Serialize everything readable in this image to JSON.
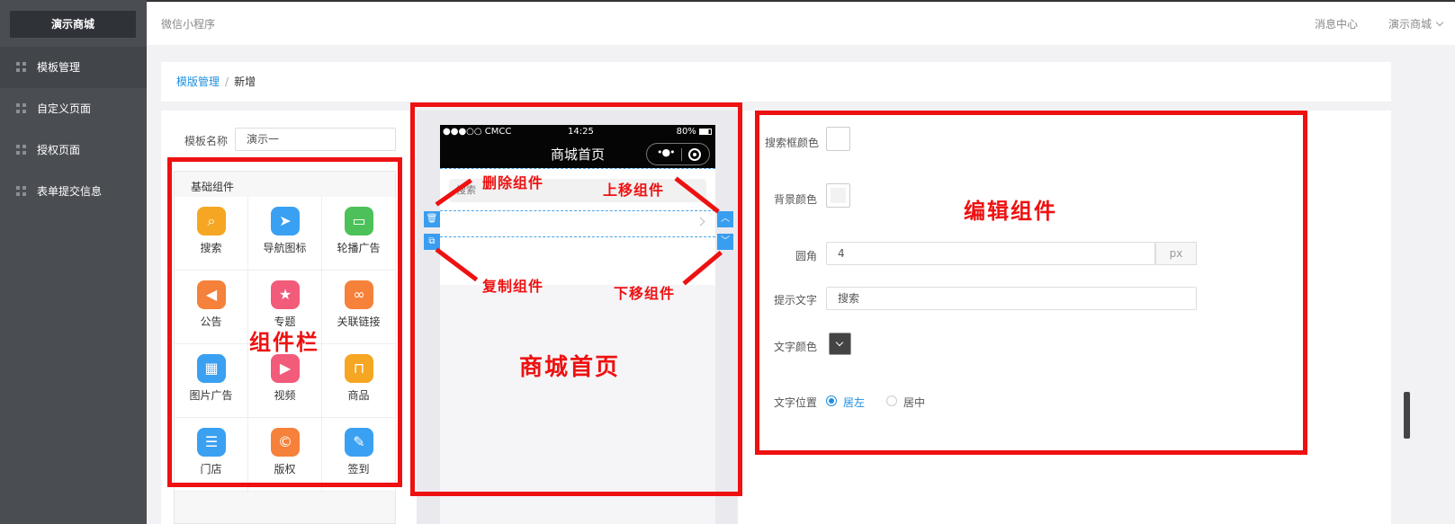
{
  "sidebar": {
    "brand": "演示商城",
    "items": [
      {
        "label": "模板管理"
      },
      {
        "label": "自定义页面"
      },
      {
        "label": "授权页面"
      },
      {
        "label": "表单提交信息"
      }
    ]
  },
  "topbar": {
    "app_title": "微信小程序",
    "messages": "消息中心",
    "user": "演示商城"
  },
  "breadcrumb": {
    "parent": "模版管理",
    "separator": "/",
    "current": "新增"
  },
  "form": {
    "name_label": "模板名称",
    "name_value": "演示一"
  },
  "components": {
    "title": "基础组件",
    "items": [
      {
        "label": "搜索",
        "icon": "search-icon",
        "color": "#f5a623"
      },
      {
        "label": "导航图标",
        "icon": "navigation-icon",
        "color": "#3aa0f2"
      },
      {
        "label": "轮播广告",
        "icon": "carousel-icon",
        "color": "#4cc15a"
      },
      {
        "label": "公告",
        "icon": "megaphone-icon",
        "color": "#f5813a"
      },
      {
        "label": "专题",
        "icon": "badge-icon",
        "color": "#f25b7a"
      },
      {
        "label": "关联链接",
        "icon": "link-icon",
        "color": "#f5813a"
      },
      {
        "label": "图片广告",
        "icon": "image-icon",
        "color": "#3aa0f2"
      },
      {
        "label": "视频",
        "icon": "video-icon",
        "color": "#f25b7a"
      },
      {
        "label": "商品",
        "icon": "bag-icon",
        "color": "#f5a623"
      },
      {
        "label": "门店",
        "icon": "store-icon",
        "color": "#3aa0f2"
      },
      {
        "label": "版权",
        "icon": "copyright-icon",
        "color": "#f5813a"
      },
      {
        "label": "签到",
        "icon": "pencil-icon",
        "color": "#3aa0f2"
      }
    ]
  },
  "phone": {
    "carrier": "●●●○○ CMCC",
    "time": "14:25",
    "battery": "80%",
    "title": "商城首页",
    "capsule_dots": "•●•",
    "search_placeholder": "搜索"
  },
  "editor": {
    "search_bg_label": "搜索框颜色",
    "bg_label": "背景颜色",
    "radius_label": "圆角",
    "radius_value": "4",
    "radius_unit": "px",
    "hint_label": "提示文字",
    "hint_value": "搜索",
    "text_color_label": "文字颜色",
    "text_pos_label": "文字位置",
    "pos_left": "居左",
    "pos_center": "居中",
    "text_color": "#444444"
  },
  "annotations": {
    "component_bar": "组件栏",
    "mall_home": "商城首页",
    "edit_component": "编辑组件",
    "delete": "删除组件",
    "move_up": "上移组件",
    "copy": "复制组件",
    "move_down": "下移组件"
  }
}
